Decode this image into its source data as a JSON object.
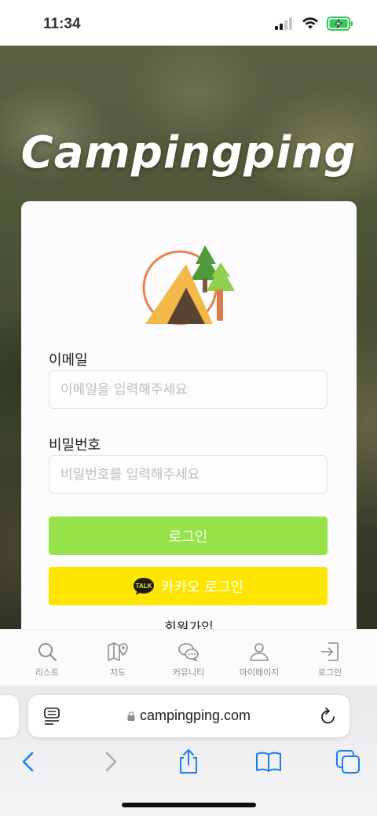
{
  "status_bar": {
    "time": "11:34"
  },
  "hero": {
    "title": "Campingping"
  },
  "login_form": {
    "email": {
      "label": "이메일",
      "placeholder": "이메일을 입력해주세요",
      "value": ""
    },
    "password": {
      "label": "비밀번호",
      "placeholder": "비밀번호를 입력해주세요",
      "value": ""
    },
    "login_button": "로그인",
    "kakao_button": "카카오 로그인",
    "kakao_badge": "TALK",
    "signup_link": "회원가입"
  },
  "tab_bar": {
    "items": [
      {
        "label": "리스트",
        "icon": "search-icon"
      },
      {
        "label": "지도",
        "icon": "map-pin-icon"
      },
      {
        "label": "커뮤니티",
        "icon": "chat-bubbles-icon"
      },
      {
        "label": "마이페이지",
        "icon": "person-icon"
      },
      {
        "label": "로그인",
        "icon": "login-icon"
      }
    ]
  },
  "browser": {
    "url": "campingping.com"
  },
  "colors": {
    "login_button": "#95e349",
    "kakao_button": "#fee500",
    "safari_accent": "#1a7cf5"
  }
}
